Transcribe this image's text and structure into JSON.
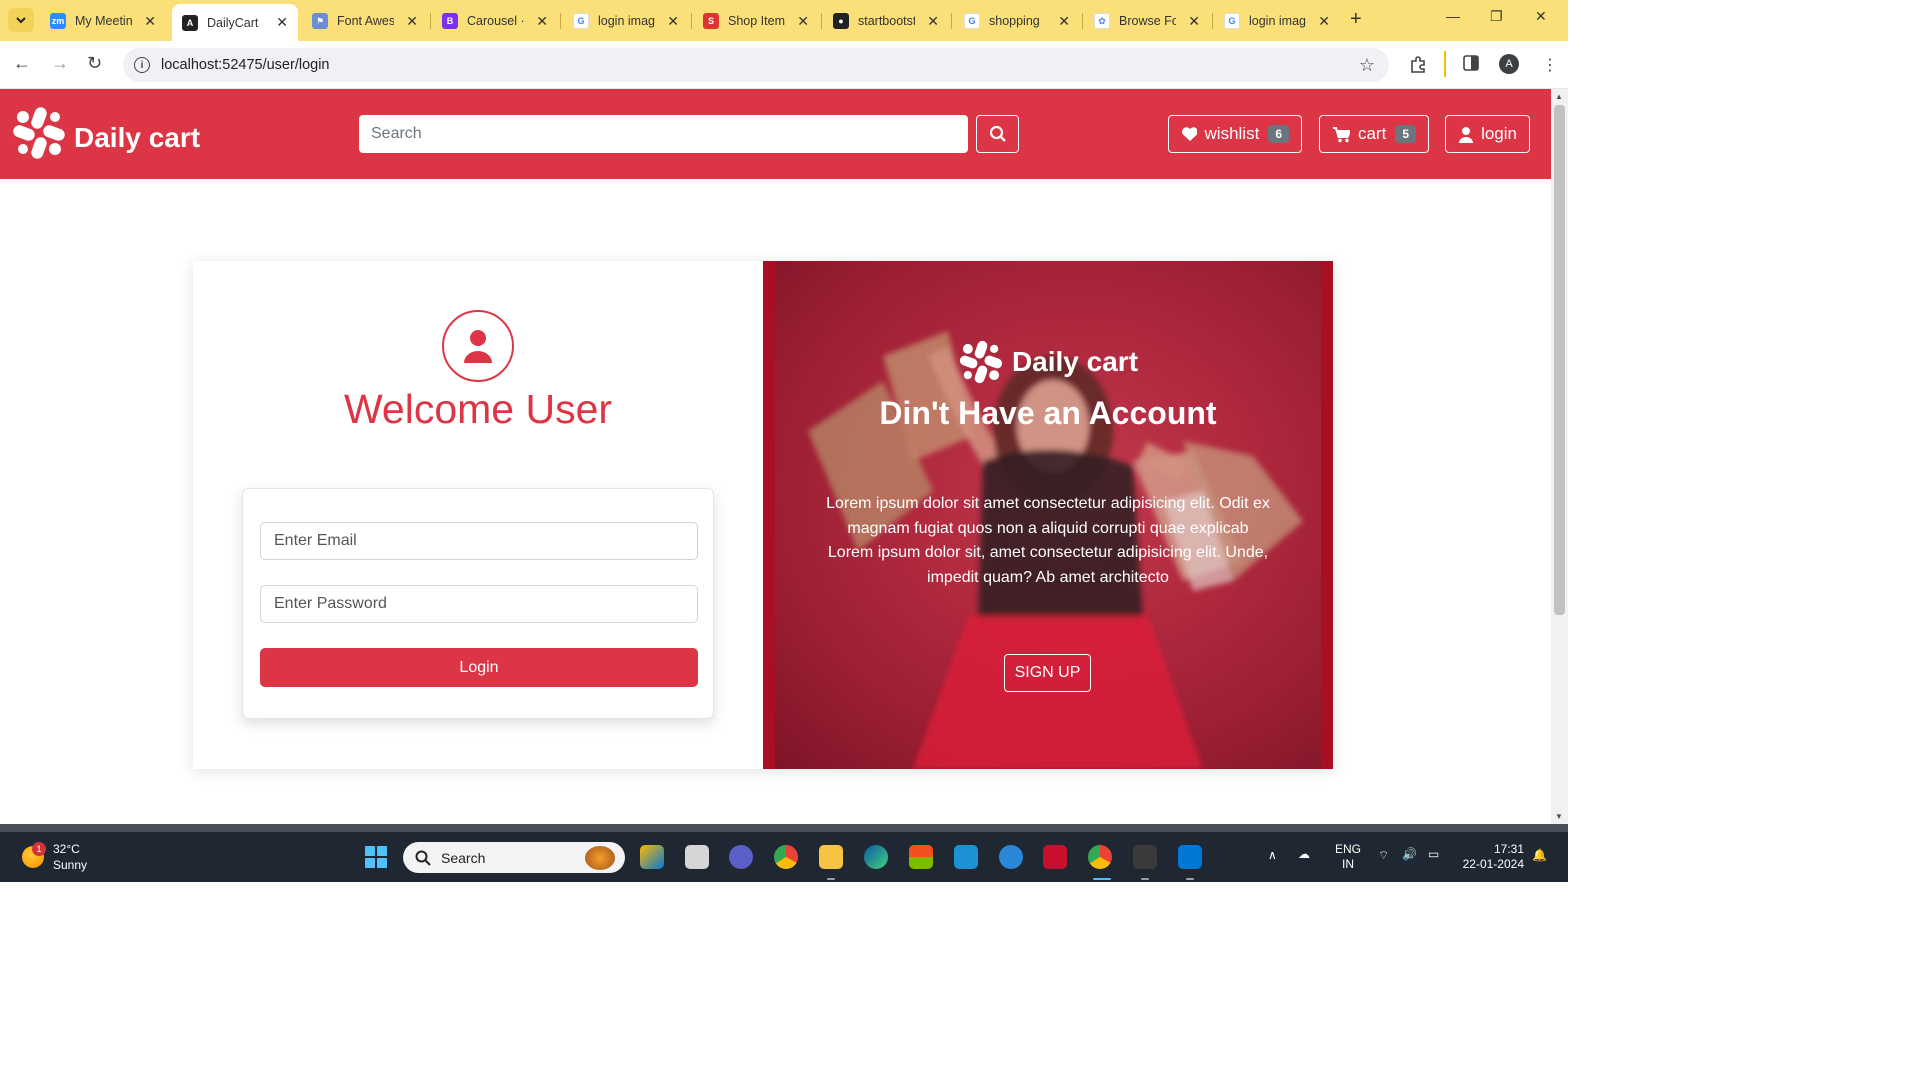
{
  "browser": {
    "tabs": [
      {
        "title": "My Meeting",
        "favicon": "zoom-icon",
        "color": "#2d8cff",
        "letter": "zm",
        "active": false
      },
      {
        "title": "DailyCart",
        "favicon": "angular-icon",
        "color": "#222222",
        "letter": "A",
        "active": true
      },
      {
        "title": "Font Awesome",
        "favicon": "flag-icon",
        "color": "#6b8fd6",
        "letter": "⚑",
        "active": false
      },
      {
        "title": "Carousel · B",
        "favicon": "bootstrap-icon",
        "color": "#7b2ff7",
        "letter": "B",
        "active": false
      },
      {
        "title": "login image",
        "favicon": "google-icon",
        "color": "#ffffff",
        "letter": "G",
        "active": false
      },
      {
        "title": "Shop Item",
        "favicon": "startbootstrap-icon",
        "color": "#dd3333",
        "letter": "S",
        "active": false
      },
      {
        "title": "startbootstrap",
        "favicon": "github-icon",
        "color": "#222222",
        "letter": "●",
        "active": false
      },
      {
        "title": "shopping",
        "favicon": "google-icon",
        "color": "#ffffff",
        "letter": "G",
        "active": false
      },
      {
        "title": "Browse Fonts",
        "favicon": "google-fonts-icon",
        "color": "#ffffff",
        "letter": "✿",
        "active": false
      },
      {
        "title": "login image",
        "favicon": "google-icon",
        "color": "#ffffff",
        "letter": "G",
        "active": false
      }
    ],
    "url": "localhost:52475/user/login",
    "profile_initial": "A"
  },
  "site": {
    "brand": "Daily cart",
    "search_placeholder": "Search",
    "wishlist_label": "wishlist",
    "wishlist_count": "6",
    "cart_label": "cart",
    "cart_count": "5",
    "login_label": "login",
    "accent": "#dc3545"
  },
  "login": {
    "welcome": "Welcome User",
    "email_placeholder": "Enter Email",
    "password_placeholder": "Enter Password",
    "button": "Login"
  },
  "promo": {
    "brand": "Daily cart",
    "heading": "Din't Have an Account",
    "text": "Lorem ipsum dolor sit amet consectetur adipisicing elit. Odit ex magnam fugiat quos non a aliquid corrupti quae explicab Lorem ipsum dolor sit, amet consectetur adipisicing elit. Unde, impedit quam? Ab amet architecto",
    "button": "SIGN UP"
  },
  "taskbar": {
    "temperature": "32°C",
    "weather": "Sunny",
    "weather_badge": "1",
    "search_label": "Search",
    "language": "ENG",
    "region": "IN",
    "time": "17:31",
    "date": "22-01-2024"
  }
}
